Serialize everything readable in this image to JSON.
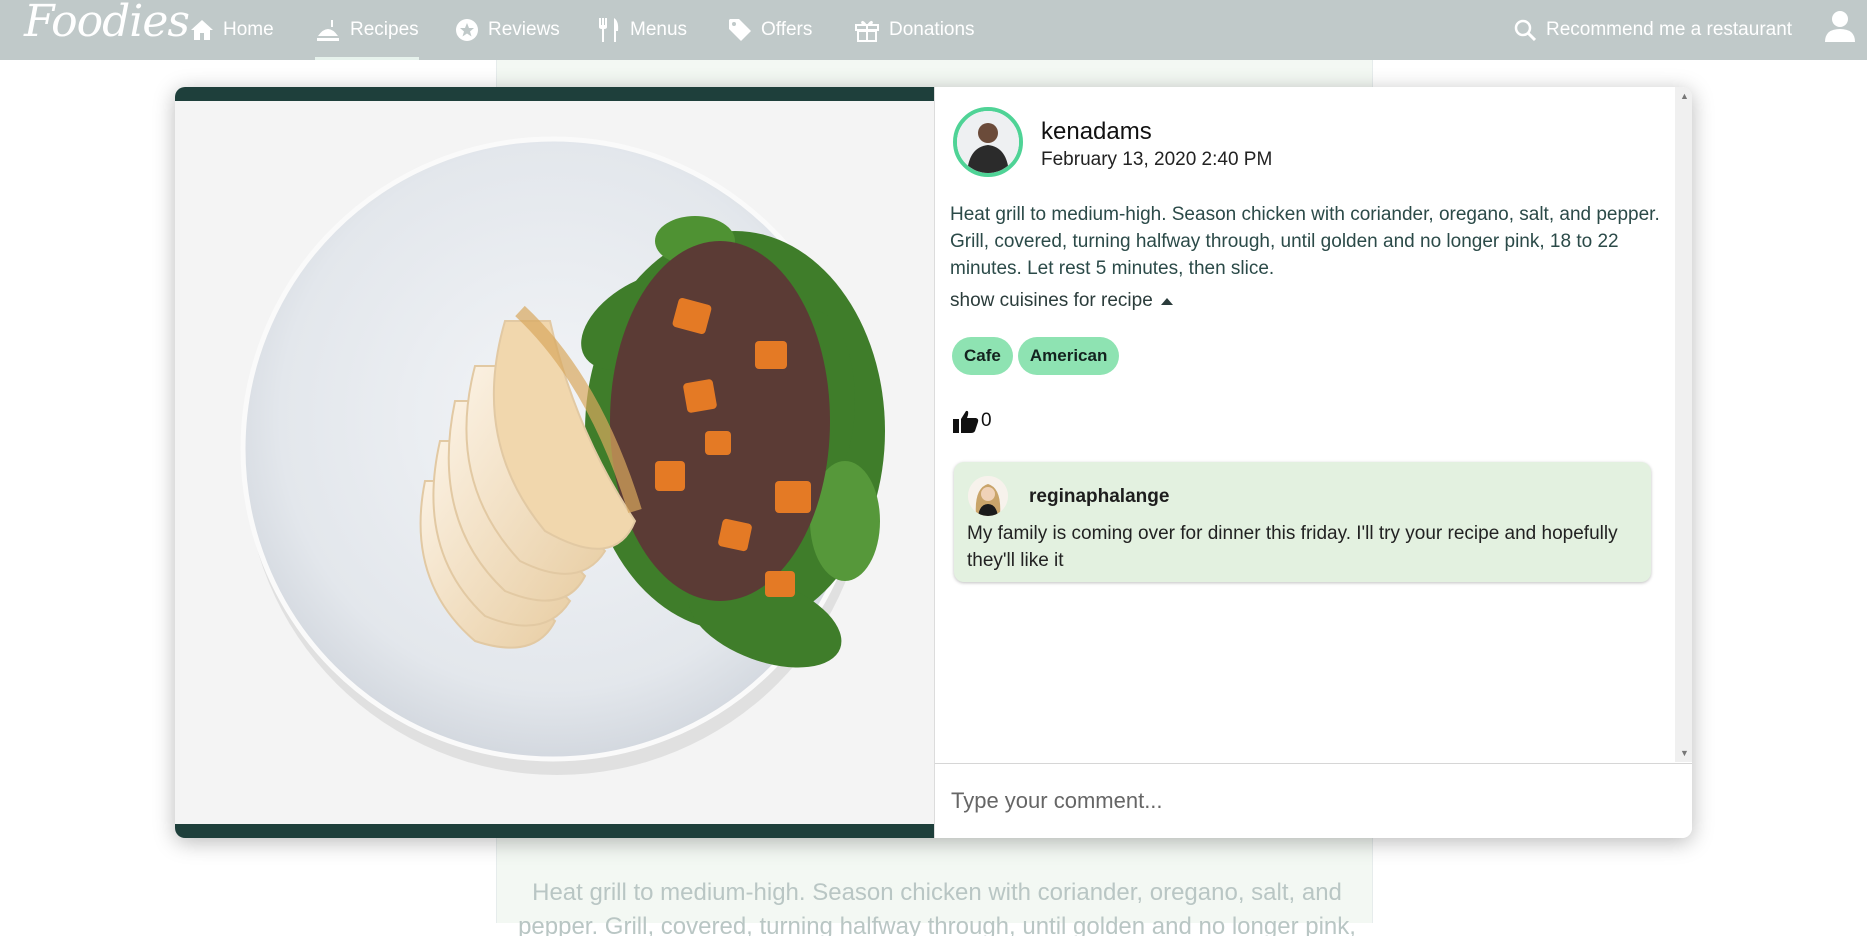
{
  "app": {
    "logo": "Foodies"
  },
  "nav": {
    "items": [
      {
        "label": "Home",
        "icon": "home-icon"
      },
      {
        "label": "Recipes",
        "icon": "recipe-icon",
        "active": true
      },
      {
        "label": "Reviews",
        "icon": "star-icon"
      },
      {
        "label": "Menus",
        "icon": "utensils-icon"
      },
      {
        "label": "Offers",
        "icon": "tag-icon"
      },
      {
        "label": "Donations",
        "icon": "gift-icon"
      }
    ],
    "recommend": "Recommend me a restaurant"
  },
  "background": {
    "text": "Heat grill to medium-high. Season chicken with coriander, oregano, salt, and pepper. Grill, covered, turning halfway through, until golden and no longer pink,"
  },
  "post": {
    "author": "kenadams",
    "date": "February 13, 2020 2:40 PM",
    "description": "Heat grill to medium-high. Season chicken with coriander, oregano, salt, and pepper. Grill, covered, turning halfway through, until golden and no longer pink, 18 to 22 minutes. Let rest 5 minutes, then slice.",
    "show_cuisines": "show cuisines for recipe",
    "cuisines": [
      "Cafe",
      "American"
    ],
    "likes": "0"
  },
  "comments": [
    {
      "user": "reginaphalange",
      "text": "My family is coming over for dinner this friday. I'll try your recipe and hopefully they'll like it"
    }
  ],
  "comment_input": {
    "placeholder": "Type your comment..."
  },
  "colors": {
    "nav_bg": "#c0c9c9",
    "accent_green": "#4fd396",
    "tag_bg": "#8ee3b2",
    "comment_bg": "#e3f1e0",
    "dark_bar": "#1e3f3b"
  }
}
